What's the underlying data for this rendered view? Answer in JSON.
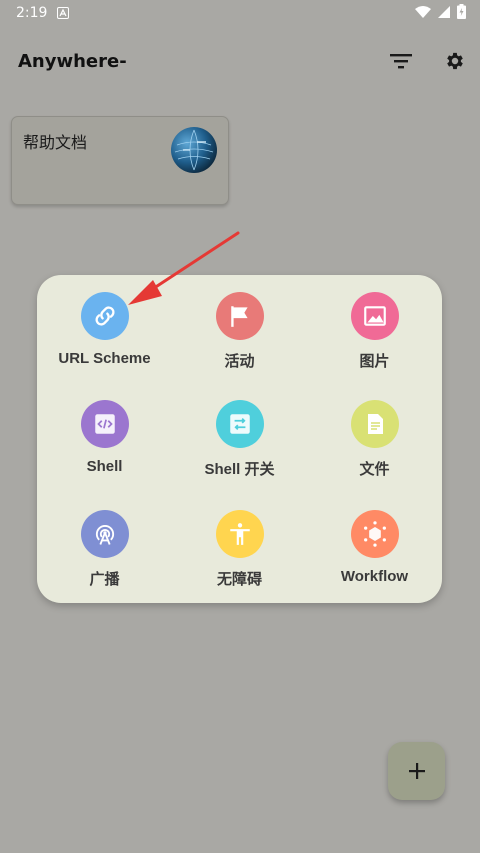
{
  "status_bar": {
    "time": "2:19"
  },
  "app_bar": {
    "title": "Anywhere-"
  },
  "doc_card": {
    "title": "帮助文档"
  },
  "panel": {
    "items": [
      {
        "label": "URL Scheme",
        "color": "#6ab3ef",
        "icon": "link-icon"
      },
      {
        "label": "活动",
        "color": "#e87a78",
        "icon": "flag-icon"
      },
      {
        "label": "图片",
        "color": "#f06a96",
        "icon": "image-icon"
      },
      {
        "label": "Shell",
        "color": "#9b76cf",
        "icon": "code-icon"
      },
      {
        "label": "Shell 开关",
        "color": "#4fcfdc",
        "icon": "swap-icon"
      },
      {
        "label": "文件",
        "color": "#d9e174",
        "icon": "file-icon"
      },
      {
        "label": "广播",
        "color": "#7f8fd3",
        "icon": "broadcast-icon"
      },
      {
        "label": "无障碍",
        "color": "#ffd54f",
        "icon": "accessibility-icon"
      },
      {
        "label": "Workflow",
        "color": "#ff8a65",
        "icon": "workflow-icon"
      }
    ]
  },
  "colors": {
    "background": "#a9a8a4",
    "panel": "#e8eadb",
    "arrow": "#e53935",
    "fab": "#9ca08b"
  }
}
